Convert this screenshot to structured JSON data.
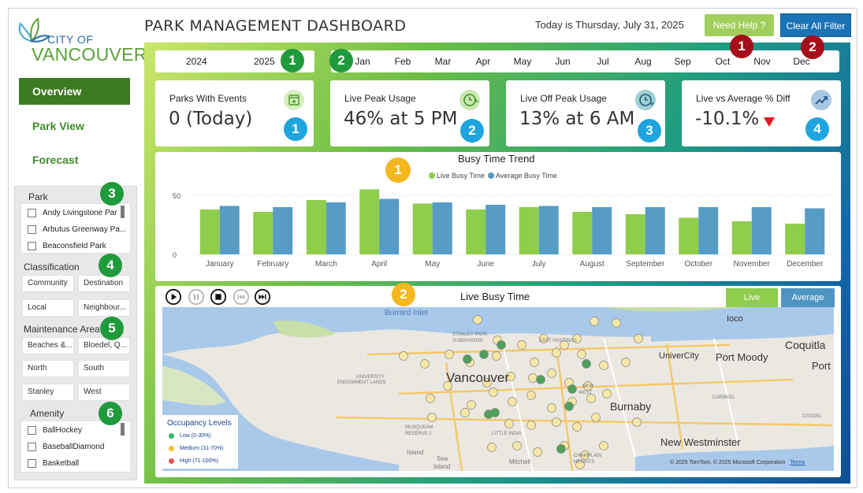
{
  "logo": {
    "line1": "CITY OF",
    "line2": "VANCOUVER"
  },
  "nav": {
    "items": [
      {
        "label": "Overview",
        "active": true
      },
      {
        "label": "Park View",
        "active": false
      },
      {
        "label": "Forecast",
        "active": false
      }
    ]
  },
  "header": {
    "title": "PARK MANAGEMENT DASHBOARD",
    "today": "Today is Thursday, July 31, 2025",
    "help_label": "Need Help ?",
    "clear_label": "Clear All Filter"
  },
  "filters": {
    "park": {
      "title": "Park",
      "items": [
        "Andy Livingstone Par",
        "Arbutus Greenway Pa...",
        "Beaconsfield Park"
      ]
    },
    "classification": {
      "title": "Classification",
      "items": [
        "Community",
        "Destination",
        "Local",
        "Neighbour..."
      ]
    },
    "maintenance": {
      "title": "Maintenance Area",
      "items": [
        "Beaches &...",
        "Bloedel, Q...",
        "North",
        "South",
        "Stanley",
        "West"
      ]
    },
    "amenity": {
      "title": "Amenity",
      "items": [
        "BallHockey",
        "BaseballDiamond",
        "Basketball"
      ]
    }
  },
  "years": [
    "2024",
    "2025"
  ],
  "months": [
    "Jan",
    "Feb",
    "Mar",
    "Apr",
    "May",
    "Jun",
    "Jul",
    "Aug",
    "Sep",
    "Oct",
    "Nov",
    "Dec"
  ],
  "kpis": [
    {
      "label": "Parks With Events",
      "value": "0 (Today)",
      "icon": "calendar-star-icon"
    },
    {
      "label": "Live Peak Usage",
      "value": "46% at 5 PM",
      "icon": "clock-up-icon"
    },
    {
      "label": "Live Off Peak Usage",
      "value": "13% at 6 AM",
      "icon": "clock-down-icon"
    },
    {
      "label": "Live vs Average % Diff",
      "value": "-10.1%",
      "icon": "trend-icon",
      "indicator": "down-triangle-icon"
    }
  ],
  "badges": {
    "green": [
      "1",
      "2",
      "3",
      "4",
      "5",
      "6"
    ],
    "blue": [
      "1",
      "2",
      "3",
      "4"
    ],
    "red": [
      "1",
      "2"
    ],
    "yellow": [
      "1",
      "2"
    ]
  },
  "chart_data": {
    "type": "bar",
    "title": "Busy Time Trend",
    "categories": [
      "January",
      "February",
      "March",
      "April",
      "May",
      "June",
      "July",
      "August",
      "September",
      "October",
      "November",
      "December"
    ],
    "series": [
      {
        "name": "Live Busy Time",
        "color": "#8fcd4c",
        "values": [
          38,
          36,
          46,
          55,
          43,
          38,
          40,
          36,
          34,
          31,
          28,
          26
        ]
      },
      {
        "name": "Average Busy Time",
        "color": "#579cc4",
        "values": [
          41,
          40,
          44,
          47,
          44,
          42,
          41,
          40,
          40,
          40,
          40,
          39
        ]
      }
    ],
    "yticks": [
      0,
      50
    ],
    "ylim": [
      0,
      60
    ],
    "grid": true,
    "legend": "top-center"
  },
  "map": {
    "title": "Live Busy Time",
    "toggle_live": "Live",
    "toggle_average": "Average",
    "labels": [
      {
        "text": "Burrard Inlet",
        "size": 10,
        "color": "#4a76b8"
      },
      {
        "text": "Ioco",
        "size": 11,
        "color": "#333"
      },
      {
        "text": "Coquitla",
        "size": 14,
        "color": "#333"
      },
      {
        "text": "UniverCity",
        "size": 11,
        "color": "#333"
      },
      {
        "text": "Port Moody",
        "size": 13,
        "color": "#333"
      },
      {
        "text": "Port",
        "size": 13,
        "color": "#333"
      },
      {
        "text": "Vancouver",
        "size": 17,
        "color": "#333"
      },
      {
        "text": "Burnaby",
        "size": 14,
        "color": "#333"
      },
      {
        "text": "New Westminster",
        "size": 13,
        "color": "#333"
      },
      {
        "text": "STANLEY PARK",
        "size": 6,
        "color": "#777"
      },
      {
        "text": "SUBDIVISION",
        "size": 6,
        "color": "#777"
      },
      {
        "text": "EAST HASTINGS",
        "size": 6,
        "color": "#777"
      },
      {
        "text": "UNIVERSITY",
        "size": 6,
        "color": "#777"
      },
      {
        "text": "ENDOWMENT LANDS",
        "size": 6,
        "color": "#777"
      },
      {
        "text": "MUSQUEAM",
        "size": 6,
        "color": "#777"
      },
      {
        "text": "RESERVE 2",
        "size": 6,
        "color": "#777"
      },
      {
        "text": "LITTLE INDIA",
        "size": 6,
        "color": "#777"
      },
      {
        "text": "Mitchell",
        "size": 8,
        "color": "#777"
      },
      {
        "text": "Island",
        "size": 8,
        "color": "#777"
      },
      {
        "text": "CHAMPLAIN",
        "size": 6,
        "color": "#777"
      },
      {
        "text": "HEIGHTS",
        "size": 6,
        "color": "#777"
      },
      {
        "text": "CARIBOO",
        "size": 6,
        "color": "#777"
      },
      {
        "text": "CITADEL",
        "size": 6,
        "color": "#777"
      },
      {
        "text": "NEW",
        "size": 6,
        "color": "#777"
      },
      {
        "text": "WEST",
        "size": 6,
        "color": "#777"
      },
      {
        "text": "Sea",
        "size": 8,
        "color": "#777"
      },
      {
        "text": "Island",
        "size": 8,
        "color": "#777"
      }
    ],
    "legend_title": "Occupancy Levels",
    "legend_items": [
      {
        "label": "Low (0-30%)",
        "color": "#3db26b"
      },
      {
        "label": "Medium (31-70%)",
        "color": "#f1c232"
      },
      {
        "label": "High (71-100%)",
        "color": "#e05a4f"
      }
    ],
    "attribution": "© 2025 TomTom, © 2025 Microsoft Corporation",
    "terms": "Terms"
  }
}
